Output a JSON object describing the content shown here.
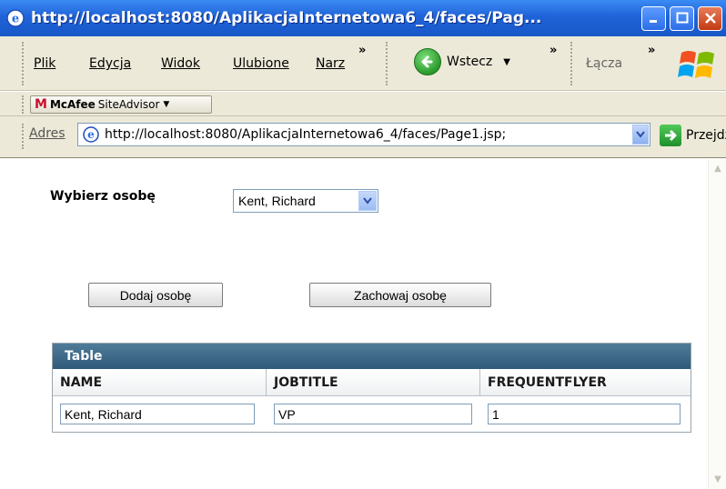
{
  "window": {
    "title": "http://localhost:8080/AplikacjaInternetowa6_4/faces/Pag..."
  },
  "menubar": {
    "items": [
      "Plik",
      "Edycja",
      "Widok",
      "Ulubione",
      "Narz"
    ],
    "overflow": "»",
    "back_label": "Wstecz",
    "links_label": "Łącza"
  },
  "mcafee": {
    "brand": "McAfee",
    "product": "SiteAdvisor"
  },
  "address": {
    "label": "Adres",
    "url": "http://localhost:8080/AplikacjaInternetowa6_4/faces/Page1.jsp;",
    "go_label": "Przejdź"
  },
  "form": {
    "select_label": "Wybierz osobę",
    "select_value": "Kent, Richard",
    "add_button": "Dodaj osobę",
    "save_button": "Zachowaj osobę"
  },
  "table": {
    "caption": "Table",
    "columns": [
      "NAME",
      "JOBTITLE",
      "FREQUENTFLYER"
    ],
    "rows": [
      [
        "Kent, Richard",
        "VP",
        "1"
      ]
    ]
  },
  "colors": {
    "titlebar": "#1f63d8",
    "chrome": "#ece9d8",
    "table_caption": "#2f5a79"
  }
}
